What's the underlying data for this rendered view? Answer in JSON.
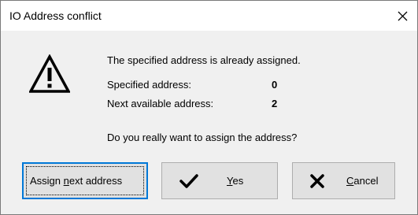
{
  "window": {
    "title": "IO Address conflict"
  },
  "message": {
    "headline": "The specified address is already assigned.",
    "specified_label": "Specified address:",
    "specified_value": "0",
    "next_label": "Next available address:",
    "next_value": "2",
    "question": "Do you really want to assign the address?"
  },
  "buttons": {
    "assign_next": {
      "pre": "Assign ",
      "mnemonic": "n",
      "post": "ext address"
    },
    "yes": {
      "pre": "",
      "mnemonic": "Y",
      "post": "es",
      "icon": "checkmark-icon"
    },
    "cancel": {
      "pre": "",
      "mnemonic": "C",
      "post": "ancel",
      "icon": "cross-icon"
    }
  },
  "icons": {
    "title_close": "close-icon",
    "message": "warning-icon"
  }
}
